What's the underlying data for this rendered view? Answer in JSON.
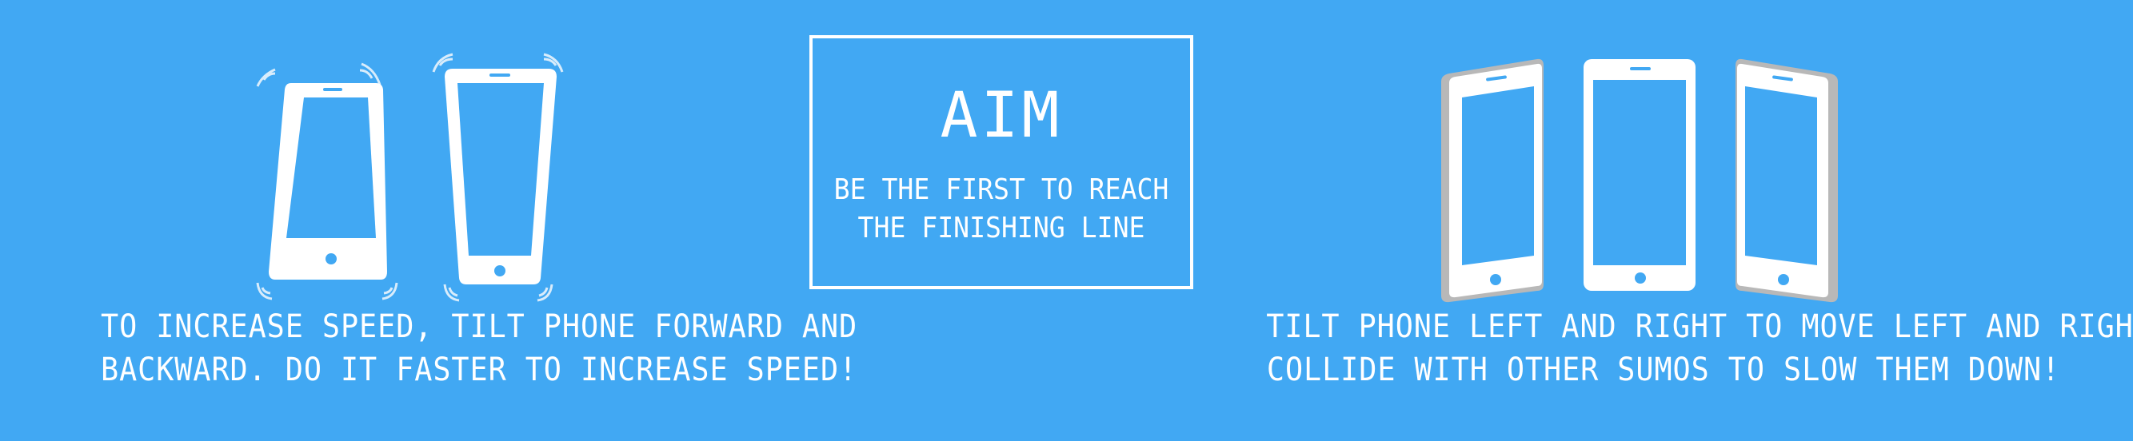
{
  "controls": {
    "speed_instruction": {
      "line1": "TO INCREASE SPEED, TILT PHONE FORWARD AND",
      "line2": "BACKWARD. DO IT FASTER TO INCREASE SPEED!"
    },
    "steer_instruction": {
      "line1": "TILT PHONE LEFT AND RIGHT TO MOVE LEFT AND RIGHT!",
      "line2": "COLLIDE WITH OTHER SUMOS TO SLOW THEM DOWN!"
    }
  },
  "aim": {
    "title": "AIM",
    "line1": "BE THE FIRST TO REACH",
    "line2": "THE FINISHING LINE"
  },
  "icons": {
    "left_group": [
      "phone-tilt-forward-icon",
      "phone-tilt-backward-icon"
    ],
    "right_group": [
      "phone-tilt-left-icon",
      "phone-upright-icon",
      "phone-tilt-right-icon"
    ]
  },
  "colors": {
    "background": "#41a8f3",
    "foreground": "#ffffff",
    "phone_shadow": "#b8b8b8"
  }
}
